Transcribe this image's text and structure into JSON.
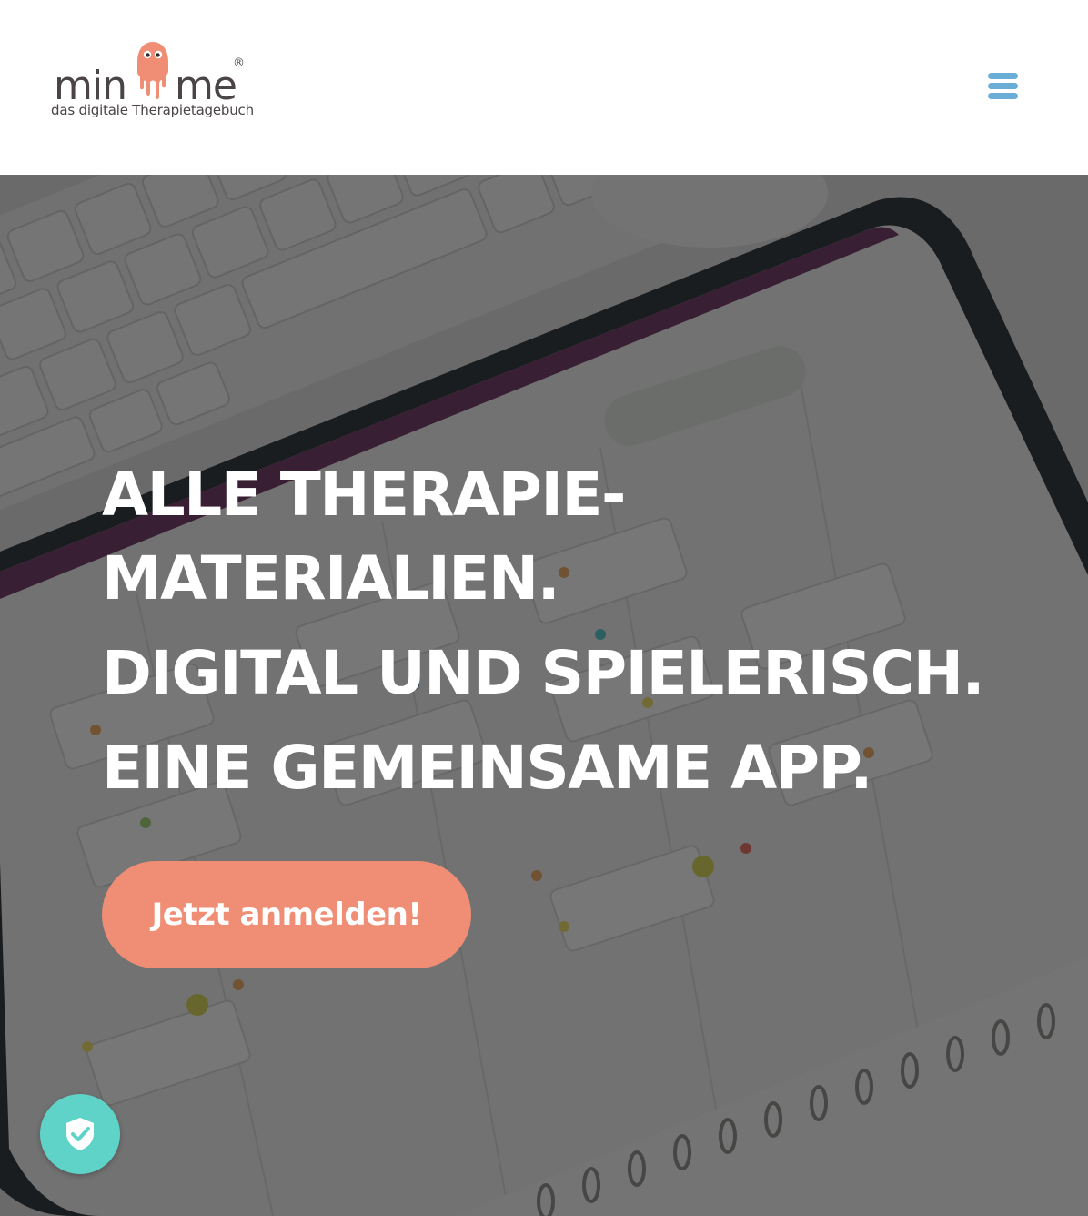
{
  "header": {
    "logo": {
      "word_left": "min",
      "word_right": "me",
      "registered": "®",
      "tagline": "das digitale Therapietagebuch"
    },
    "menu_icon": "hamburger-menu-icon"
  },
  "hero": {
    "title_lines": [
      "ALLE THERAPIE-",
      "MATERIALIEN.",
      "DIGITAL UND SPIELERISCH.",
      "EINE GEMEINSAME APP."
    ],
    "cta_label": "Jetzt anmelden!"
  },
  "privacy_badge": {
    "icon": "shield-check-icon"
  },
  "colors": {
    "brand_coral": "#ef8e74",
    "menu_blue": "#6aaed8",
    "privacy_teal": "#5fd3c8",
    "logo_text": "#4a4446"
  }
}
